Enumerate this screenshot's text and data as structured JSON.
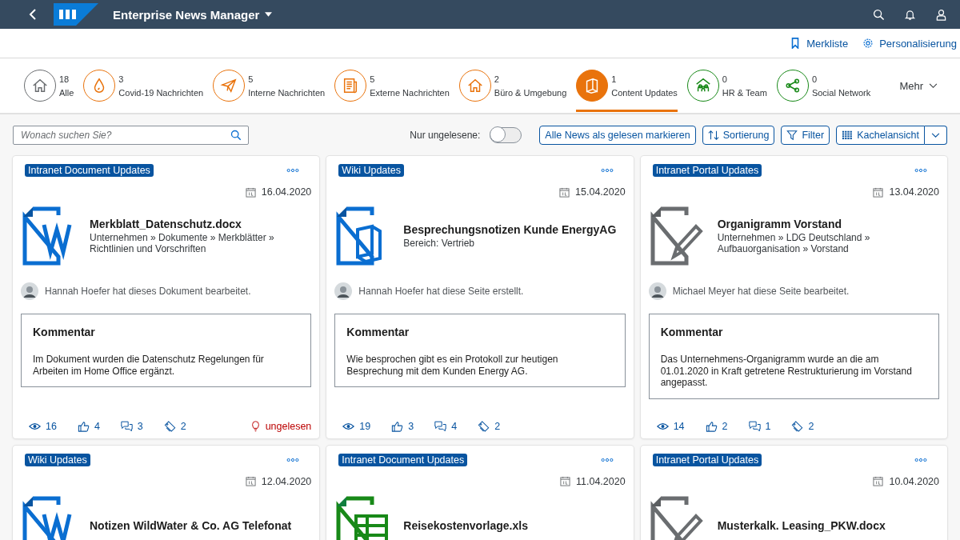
{
  "shell": {
    "title": "Enterprise News Manager"
  },
  "subheader": {
    "links": [
      {
        "label": "Merkliste"
      },
      {
        "label": "Personalisierung"
      }
    ]
  },
  "categories": [
    {
      "count": "18",
      "label": "Alle",
      "color": "#6a6d70",
      "selected": false
    },
    {
      "count": "3",
      "label": "Covid-19 Nachrichten",
      "color": "#e9730c",
      "selected": false
    },
    {
      "count": "5",
      "label": "Interne Nachrichten",
      "color": "#e9730c",
      "selected": false
    },
    {
      "count": "5",
      "label": "Externe Nachrichten",
      "color": "#e9730c",
      "selected": false
    },
    {
      "count": "2",
      "label": "Büro & Umgebung",
      "color": "#e9730c",
      "selected": false
    },
    {
      "count": "1",
      "label": "Content Updates",
      "color": "#e9730c",
      "selected": true
    },
    {
      "count": "0",
      "label": "HR & Team",
      "color": "#188918",
      "selected": false
    },
    {
      "count": "0",
      "label": "Social Network",
      "color": "#188918",
      "selected": false
    }
  ],
  "more": "Mehr",
  "toolbar": {
    "search": {
      "placeholder": "Wonach suchen Sie?"
    },
    "unread_toggle": {
      "label": "Nur ungelesene:",
      "on": false
    },
    "buttons": [
      {
        "label": "Alle News als gelesen markieren"
      },
      {
        "label": "Sortierung"
      },
      {
        "label": "Filter"
      }
    ],
    "view": {
      "label": "Kachelansicht"
    }
  },
  "cards": [
    {
      "tag": "Intranet Document Updates",
      "date": "16.04.2020",
      "kind": "word",
      "title": "Merkblatt_Datenschutz.docx",
      "path": "Unternehmen » Dokumente » Merkblätter » Richtlinien und Vorschriften",
      "activity": "Hannah Hoefer hat dieses Dokument bearbeitet.",
      "comment_title": "Kommentar",
      "comment": "Im Dokument wurden die Datenschutz Regelungen für Arbeiten im Home Office ergänzt.",
      "views": "16",
      "likes": "4",
      "comments": "3",
      "tags": "2",
      "status": "ungelesen"
    },
    {
      "tag": "Wiki Updates",
      "date": "15.04.2020",
      "kind": "book",
      "title": "Besprechungsnotizen Kunde EnergyAG",
      "path": "Bereich: Vertrieb",
      "activity": "Hannah Hoefer hat diese Seite erstellt.",
      "comment_title": "Kommentar",
      "comment": "Wie besprochen gibt es ein Protokoll zur heutigen Besprechung mit dem Kunden Energy AG.",
      "views": "19",
      "likes": "3",
      "comments": "4",
      "tags": "2"
    },
    {
      "tag": "Intranet Portal Updates",
      "date": "13.04.2020",
      "kind": "pencil",
      "title": "Organigramm Vorstand",
      "path": "Unternehmen » LDG Deutschland » Aufbauorganisation » Vorstand",
      "activity": "Michael Meyer hat diese Seite bearbeitet.",
      "comment_title": "Kommentar",
      "comment": "Das Unternehmens-Organigramm wurde an die am 01.01.2020 in Kraft getretene Restrukturierung im Vorstand angepasst.",
      "views": "14",
      "likes": "2",
      "comments": "1",
      "tags": "2"
    },
    {
      "tag": "Wiki Updates",
      "date": "12.04.2020",
      "kind": "word",
      "title": "Notizen WildWater & Co. AG Telefonat"
    },
    {
      "tag": "Intranet Document Updates",
      "date": "11.04.2020",
      "kind": "excel",
      "title": "Reisekostenvorlage.xls"
    },
    {
      "tag": "Intranet Portal Updates",
      "date": "10.04.2020",
      "kind": "pencil",
      "title": "Musterkalk. Leasing_PKW.docx"
    }
  ]
}
